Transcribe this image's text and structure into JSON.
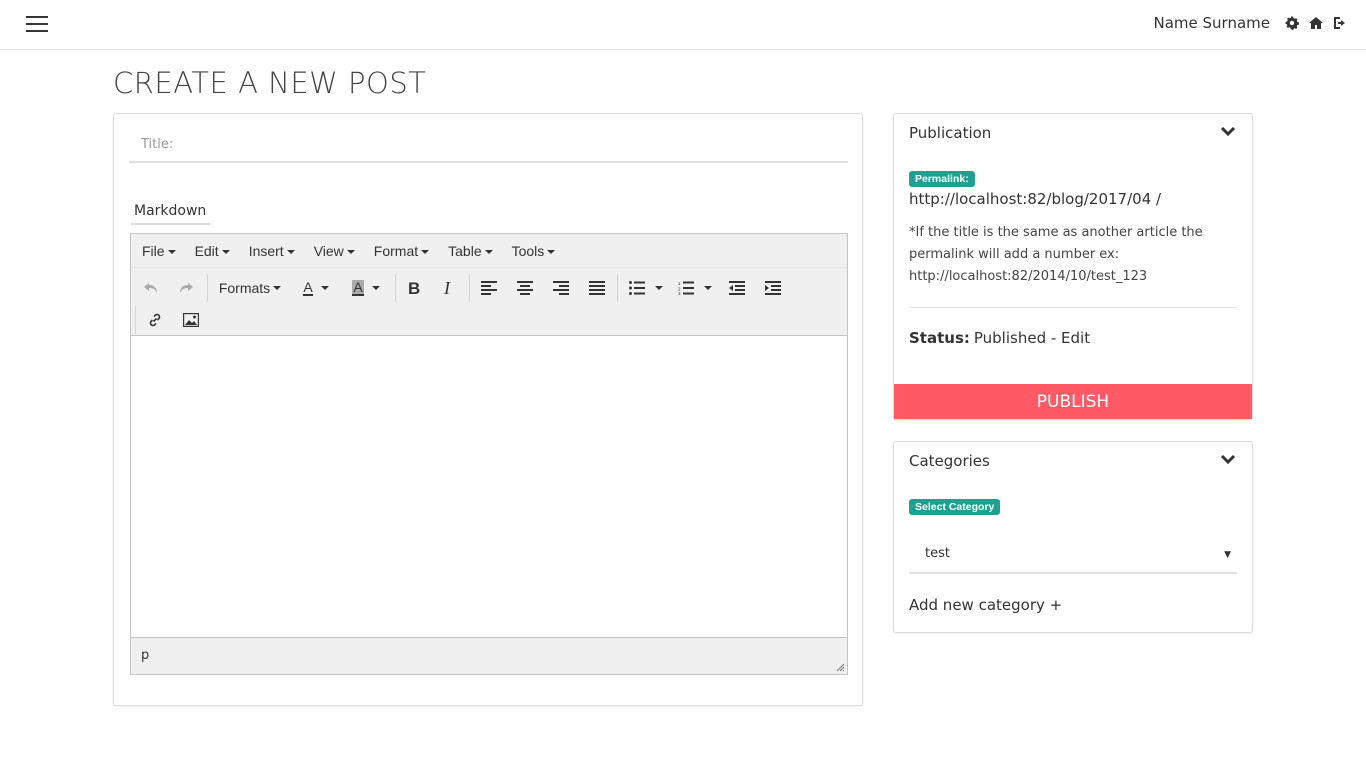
{
  "header": {
    "user_name": "Name Surname",
    "icons": [
      "menu-icon",
      "gear-icon",
      "home-icon",
      "sign-out-icon"
    ]
  },
  "page": {
    "title": "CREATE A NEW POST"
  },
  "post_form": {
    "title_placeholder": "Title:",
    "mode_tab": "Markdown"
  },
  "editor": {
    "menus": [
      "File",
      "Edit",
      "Insert",
      "View",
      "Format",
      "Table",
      "Tools"
    ],
    "formats_label": "Formats",
    "text_color_label": "A",
    "bg_color_label": "A",
    "path": "p"
  },
  "publication": {
    "heading": "Publication",
    "permalink_badge": "Permalink:",
    "permalink": "http://localhost:82/blog/2017/04 /",
    "note_line1": "*If the title is the same as another article the",
    "note_line2": "permalink will add a number ex:",
    "note_line3": "http://localhost:82/2014/10/test_123",
    "status_label": "Status:",
    "status_value": "Published - Edit",
    "publish_label": "PUBLISH",
    "publish_color": "#ff5a66",
    "badge_color": "#1fa192"
  },
  "categories": {
    "heading": "Categories",
    "select_badge": "Select Category",
    "selected": "test",
    "add_new": "Add new category +"
  }
}
